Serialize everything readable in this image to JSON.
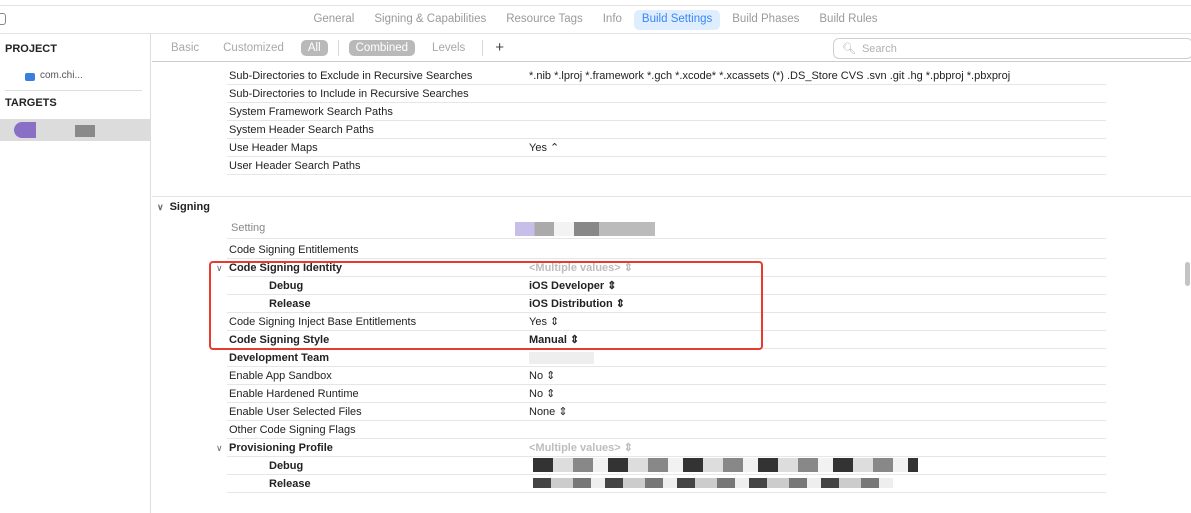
{
  "tabs": [
    {
      "label": "General"
    },
    {
      "label": "Signing & Capabilities"
    },
    {
      "label": "Resource Tags"
    },
    {
      "label": "Info"
    },
    {
      "label": "Build Settings",
      "active": true
    },
    {
      "label": "Build Phases"
    },
    {
      "label": "Build Rules"
    }
  ],
  "sidebar": {
    "project_header": "PROJECT",
    "project_item": "com.chi...",
    "targets_header": "TARGETS"
  },
  "filter": {
    "basic": "Basic",
    "customized": "Customized",
    "all": "All",
    "combined": "Combined",
    "levels": "Levels",
    "add": "+",
    "search_placeholder": "Search"
  },
  "search_rows": [
    {
      "name": "Sub-Directories to Exclude in Recursive Searches",
      "value": "*.nib *.lproj *.framework *.gch *.xcode* *.xcassets (*) .DS_Store CVS .svn .git .hg *.pbproj *.pbxproj"
    },
    {
      "name": "Sub-Directories to Include in Recursive Searches",
      "value": ""
    },
    {
      "name": "System Framework Search Paths",
      "value": ""
    },
    {
      "name": "System Header Search Paths",
      "value": ""
    },
    {
      "name": "Use Header Maps",
      "value": "Yes ⌃"
    },
    {
      "name": "User Header Search Paths",
      "value": ""
    }
  ],
  "signing": {
    "section_title": "Signing",
    "setting_header": "Setting",
    "rows": [
      {
        "name": "Code Signing Entitlements",
        "value": ""
      },
      {
        "name": "Code Signing Identity",
        "value": "<Multiple values> ⇕",
        "bold": true,
        "disclosure": true,
        "muted": true
      },
      {
        "name": "Debug",
        "value": "iOS Developer ⇕",
        "bold": true,
        "sub": true
      },
      {
        "name": "Release",
        "value": "iOS Distribution ⇕",
        "bold": true,
        "sub": true
      },
      {
        "name": "Code Signing Inject Base Entitlements",
        "value": "Yes ⇕"
      },
      {
        "name": "Code Signing Style",
        "value": "Manual ⇕",
        "bold": true
      },
      {
        "name": "Development Team",
        "value": "",
        "bold": true
      },
      {
        "name": "Enable App Sandbox",
        "value": "No ⇕"
      },
      {
        "name": "Enable Hardened Runtime",
        "value": "No ⇕"
      },
      {
        "name": "Enable User Selected Files",
        "value": "None ⇕"
      },
      {
        "name": "Other Code Signing Flags",
        "value": ""
      },
      {
        "name": "Provisioning Profile",
        "value": "<Multiple values> ⇕",
        "bold": true,
        "disclosure": true,
        "muted": true
      },
      {
        "name": "Debug",
        "value": "",
        "bold": true,
        "sub": true
      },
      {
        "name": "Release",
        "value": "",
        "bold": true,
        "sub": true
      }
    ]
  },
  "colors": {
    "accent": "#3b86f7",
    "highlight": "#e83a2f"
  }
}
